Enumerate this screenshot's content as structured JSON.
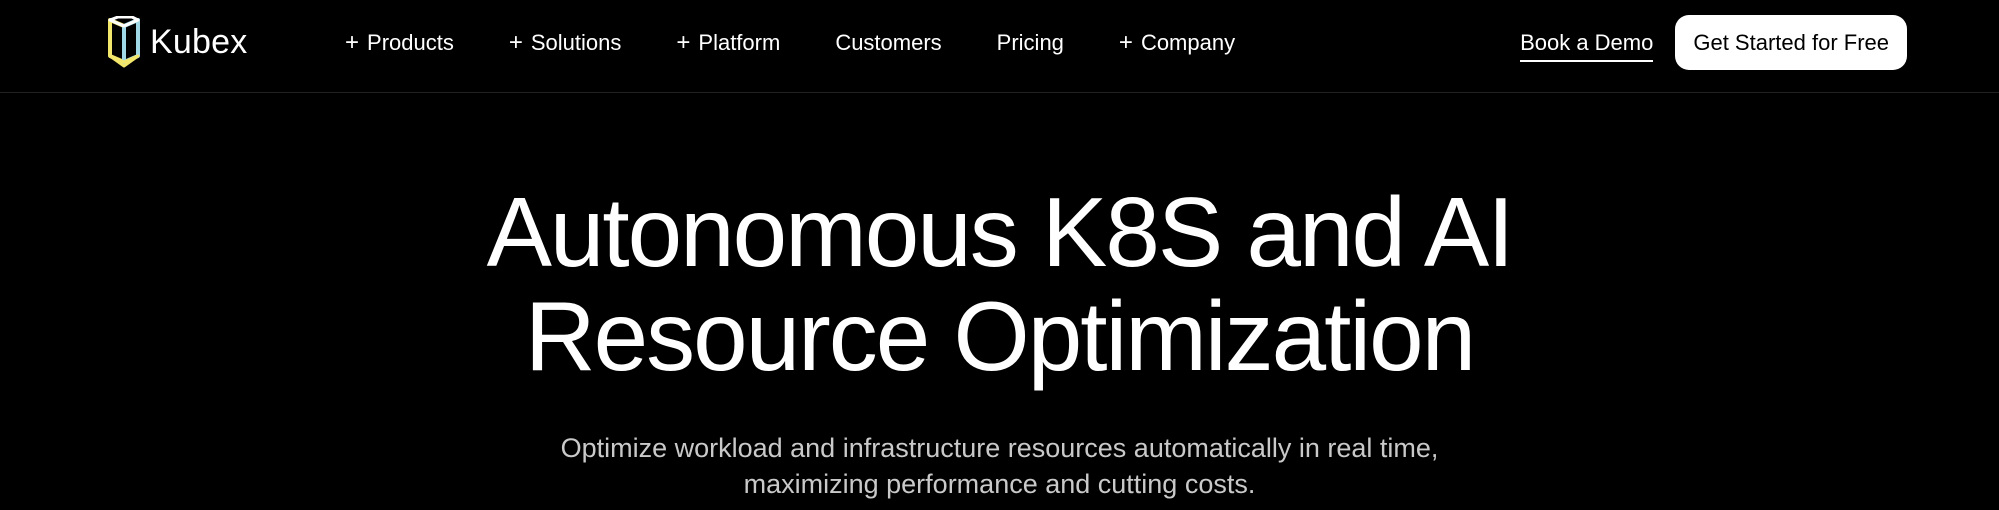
{
  "brand": {
    "name": "Kubex",
    "colors": {
      "yellow": "#f2e66b",
      "cyan": "#9fd8e6",
      "accent": "#ffffff"
    }
  },
  "nav": {
    "items": [
      {
        "label": "Products",
        "has_submenu": true
      },
      {
        "label": "Solutions",
        "has_submenu": true
      },
      {
        "label": "Platform",
        "has_submenu": true
      },
      {
        "label": "Customers",
        "has_submenu": false
      },
      {
        "label": "Pricing",
        "has_submenu": false
      },
      {
        "label": "Company",
        "has_submenu": true
      }
    ],
    "plus_glyph": "+",
    "book_demo": "Book a Demo",
    "get_started": "Get Started for Free"
  },
  "hero": {
    "title_line1": "Autonomous K8S and AI",
    "title_line2": "Resource Optimization",
    "subtitle_line1": "Optimize workload and infrastructure resources automatically in real time,",
    "subtitle_line2": "maximizing performance and cutting costs."
  }
}
